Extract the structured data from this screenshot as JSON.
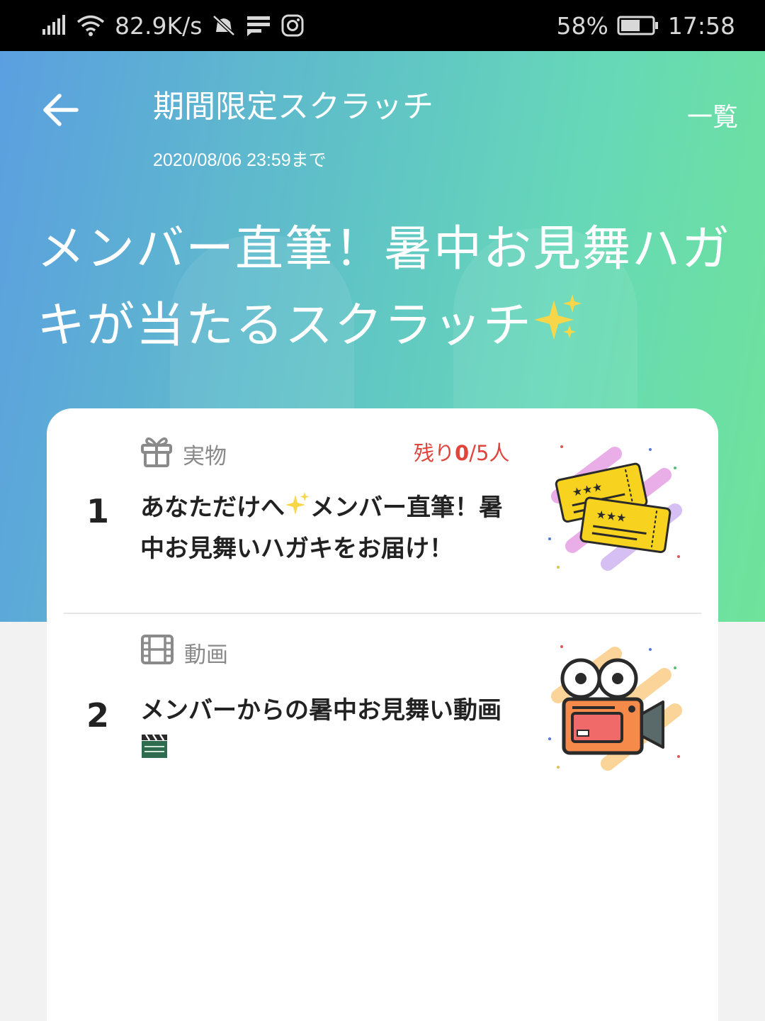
{
  "status_bar": {
    "speed": "82.9K/s",
    "battery": "58%",
    "time": "17:58"
  },
  "header": {
    "title": "期間限定スクラッチ",
    "deadline": "2020/08/06 23:59まで",
    "list_link": "一覧"
  },
  "campaign": {
    "title": "メンバー直筆！暑中お見舞ハガキが当たるスクラッチ"
  },
  "prizes": [
    {
      "number": "1",
      "type_label": "実物",
      "type_icon": "gift-icon",
      "remaining_prefix": "残り",
      "remaining_count": "0",
      "remaining_suffix": "/5人",
      "desc_part1": "あなただけへ",
      "desc_part2": "メンバー直筆！暑中お見舞いハガキをお届け！",
      "image": "ticket-icon"
    },
    {
      "number": "2",
      "type_label": "動画",
      "type_icon": "film-icon",
      "desc": "メンバーからの暑中お見舞い動画",
      "image": "movie-camera-icon"
    }
  ],
  "colors": {
    "accent_remaining": "#e0443a",
    "hero_start": "#5b9fe0",
    "hero_end": "#6fe39a"
  }
}
